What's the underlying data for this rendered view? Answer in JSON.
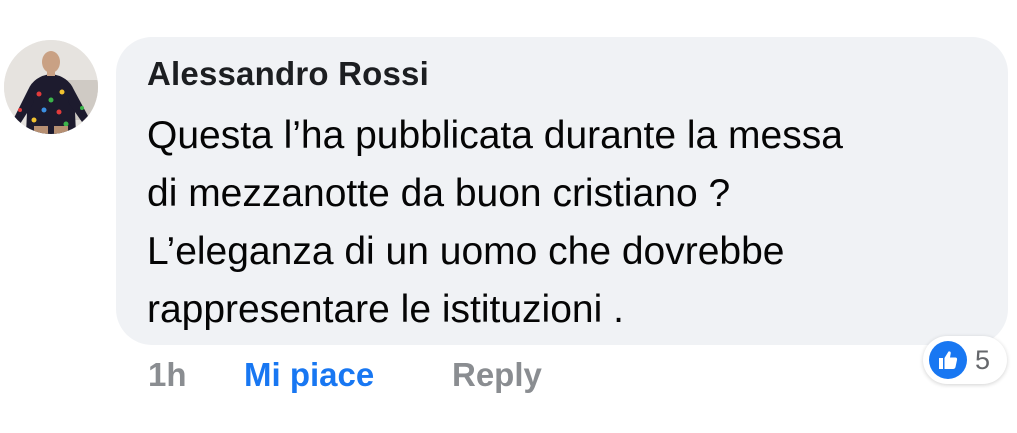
{
  "comment": {
    "author": "Alessandro Rossi",
    "text_lines": [
      "Questa l’ha pubblicata durante la messa",
      "di mezzanotte da buon cristiano ?",
      "L’eleganza di un uomo che dovrebbe",
      "rappresentare le istituzioni ."
    ],
    "timestamp": "1h",
    "like_label": "Mi piace",
    "reply_label": "Reply",
    "reactions": {
      "icon": "thumbs-up-icon",
      "count": "5"
    }
  },
  "colors": {
    "bubble_bg": "#f0f2f5",
    "like_active": "#1877f2",
    "muted": "#8a8d91"
  }
}
